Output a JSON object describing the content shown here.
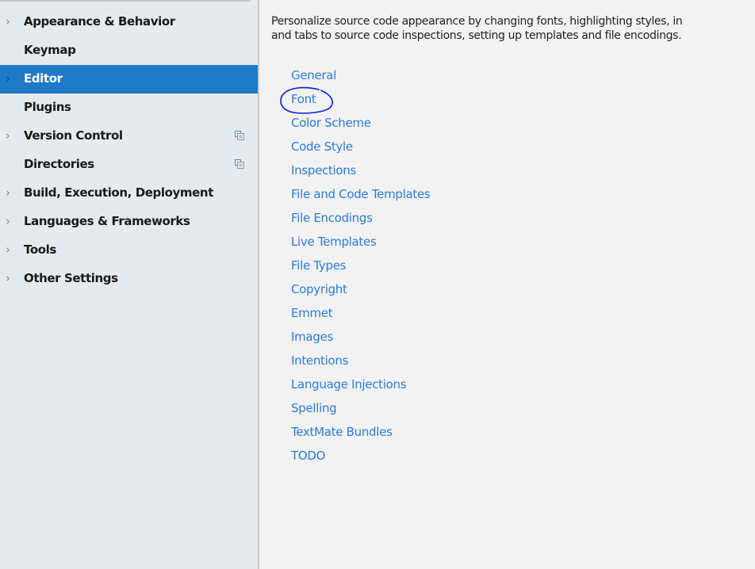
{
  "sidebar": {
    "items": [
      {
        "label": "Appearance & Behavior",
        "expandable": true,
        "selected": false,
        "project_icon": false
      },
      {
        "label": "Keymap",
        "expandable": false,
        "selected": false,
        "project_icon": false
      },
      {
        "label": "Editor",
        "expandable": true,
        "selected": true,
        "project_icon": false
      },
      {
        "label": "Plugins",
        "expandable": false,
        "selected": false,
        "project_icon": false
      },
      {
        "label": "Version Control",
        "expandable": true,
        "selected": false,
        "project_icon": true
      },
      {
        "label": "Directories",
        "expandable": false,
        "selected": false,
        "project_icon": true
      },
      {
        "label": "Build, Execution, Deployment",
        "expandable": true,
        "selected": false,
        "project_icon": false
      },
      {
        "label": "Languages & Frameworks",
        "expandable": true,
        "selected": false,
        "project_icon": false
      },
      {
        "label": "Tools",
        "expandable": true,
        "selected": false,
        "project_icon": false
      },
      {
        "label": "Other Settings",
        "expandable": true,
        "selected": false,
        "project_icon": false
      }
    ],
    "chevron_glyph": "›",
    "selected_color": "#1E79C7"
  },
  "main": {
    "description_line1": "Personalize source code appearance by changing fonts, highlighting styles, in",
    "description_line2": "and tabs to source code inspections, setting up templates and file encodings.",
    "links": [
      "General",
      "Font",
      "Color Scheme",
      "Code Style",
      "Inspections",
      "File and Code Templates",
      "File Encodings",
      "Live Templates",
      "File Types",
      "Copyright",
      "Emmet",
      "Images",
      "Intentions",
      "Language Injections",
      "Spelling",
      "TextMate Bundles",
      "TODO"
    ],
    "link_color": "#2A7CD3",
    "annotation": {
      "target": "Font",
      "shape": "hand-drawn-circle",
      "color": "#0A1ED0"
    }
  }
}
